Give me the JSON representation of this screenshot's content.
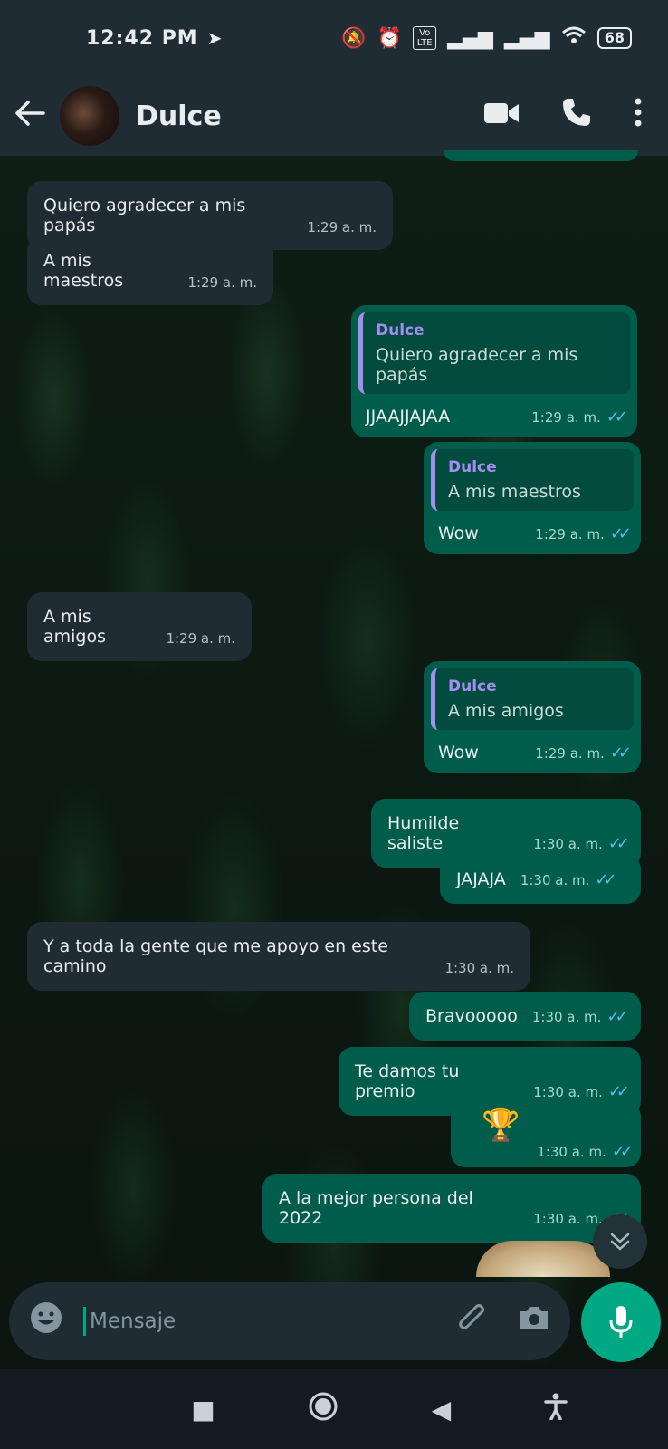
{
  "status_bar": {
    "time": "12:42 PM",
    "nav_icon": "navigation-icon",
    "icons": [
      "muted-bell-icon",
      "alarm-icon",
      "volte-icon",
      "signal-icon",
      "signal-icon",
      "wifi-icon"
    ],
    "volte": "Vo LTE",
    "battery": "68"
  },
  "header": {
    "contact_name": "Dulce"
  },
  "messages": [
    {
      "text": "Quiero agradecer a mis papás",
      "time": "1:29 a. m."
    },
    {
      "text": "A mis maestros",
      "time": "1:29 a. m."
    },
    {
      "quote_name": "Dulce",
      "quote_text": "Quiero agradecer a mis papás",
      "text": "JJAAJJAJAA",
      "time": "1:29 a. m."
    },
    {
      "quote_name": "Dulce",
      "quote_text": "A mis maestros",
      "text": "Wow",
      "time": "1:29 a. m."
    },
    {
      "text": "A mis amigos",
      "time": "1:29 a. m."
    },
    {
      "quote_name": "Dulce",
      "quote_text": "A mis amigos",
      "text": "Wow",
      "time": "1:29 a. m."
    },
    {
      "text": "Humilde saliste",
      "time": "1:30 a. m."
    },
    {
      "text": "JAJAJA",
      "time": "1:30 a. m."
    },
    {
      "text": "Y a toda la gente que me apoyo en este camino",
      "time": "1:30 a. m."
    },
    {
      "text": "Bravooooo",
      "time": "1:30 a. m."
    },
    {
      "text": "Te damos tu premio",
      "time": "1:30 a. m."
    },
    {
      "text": "🏆",
      "time": "1:30 a. m."
    },
    {
      "text": "A la mejor persona del 2022",
      "time": "1:30 a. m."
    }
  ],
  "composer": {
    "placeholder": "Mensaje"
  },
  "colors": {
    "incoming_bubble": "#1f2c34",
    "outgoing_bubble": "#005c4b",
    "accent": "#00a884",
    "read_ticks": "#53bdeb",
    "quote_name": "#a48ef0"
  }
}
